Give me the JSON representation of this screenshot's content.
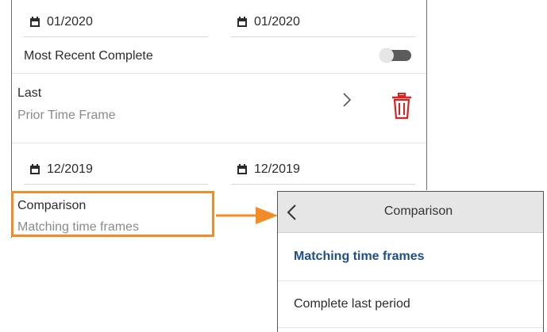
{
  "date_range_top": {
    "start": "01/2020",
    "end": "01/2020"
  },
  "most_recent_complete": {
    "label": "Most Recent Complete",
    "enabled": false
  },
  "time_frame_row": {
    "title": "Last",
    "subtitle": "Prior Time Frame"
  },
  "date_range_bottom": {
    "start": "12/2019",
    "end": "12/2019"
  },
  "comparison_row": {
    "title": "Comparison",
    "subtitle": "Matching time frames"
  },
  "comparison_popup": {
    "title": "Comparison",
    "options": [
      {
        "label": "Matching time frames",
        "selected": true
      },
      {
        "label": "Complete last period",
        "selected": false
      }
    ]
  },
  "colors": {
    "highlight": "#f28c28",
    "delete": "#e02020",
    "selected_option": "#1f4e8c",
    "toggle_track": "#5c5c5c"
  },
  "icons": [
    "calendar-icon",
    "chevron-right-icon",
    "trash-icon",
    "chevron-left-icon",
    "arrow-right-icon"
  ]
}
